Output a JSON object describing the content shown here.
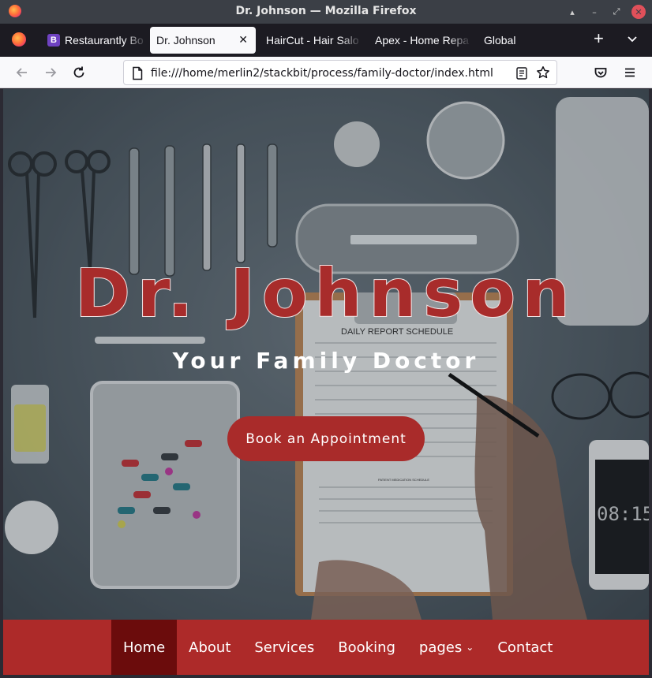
{
  "window": {
    "title": "Dr. Johnson — Mozilla Firefox",
    "controls": {
      "minimize_glyph": "▴",
      "min_glyph": "–",
      "restore_glyph": "⤢",
      "close_glyph": "✕"
    }
  },
  "tabs": [
    {
      "label": "Restaurantly Bo",
      "favicon": "B",
      "active": false
    },
    {
      "label": "Dr. Johnson",
      "active": true,
      "close_glyph": "✕"
    },
    {
      "label": "HairCut - Hair Salo",
      "active": false
    },
    {
      "label": "Apex - Home Repa",
      "active": false
    },
    {
      "label": "Global",
      "active": false
    }
  ],
  "tab_actions": {
    "new_tab_glyph": "+",
    "list_all_icon": "chevron-down-icon"
  },
  "navigation": {
    "url": "file:///home/merlin2/stackbit/process/family-doctor/index.html",
    "icons": [
      "back-arrow-icon",
      "forward-arrow-icon",
      "reload-icon",
      "page-icon",
      "reader-view-icon",
      "bookmark-star-icon",
      "pocket-icon",
      "menu-icon"
    ]
  },
  "hero": {
    "title": "Dr. Johnson",
    "subtitle": "Your Family Doctor",
    "cta_label": "Book an Appointment",
    "background_props": {
      "clipboard_heading": "DAILY REPORT SCHEDULE",
      "clipboard_subheading": "PATIENT MEDICATION SCHEDULE",
      "phone_clock": "08:15"
    }
  },
  "menu": {
    "items": [
      {
        "label": "Home",
        "active": true
      },
      {
        "label": "About"
      },
      {
        "label": "Services"
      },
      {
        "label": "Booking"
      },
      {
        "label": "pages",
        "dropdown": true,
        "chevron": "⌄"
      },
      {
        "label": "Contact"
      }
    ]
  },
  "colors": {
    "brand_red": "#ad2a29",
    "active_menu": "#6b0c0c",
    "title_red": "#a82c2b",
    "chrome_dark": "#1c1b22"
  }
}
